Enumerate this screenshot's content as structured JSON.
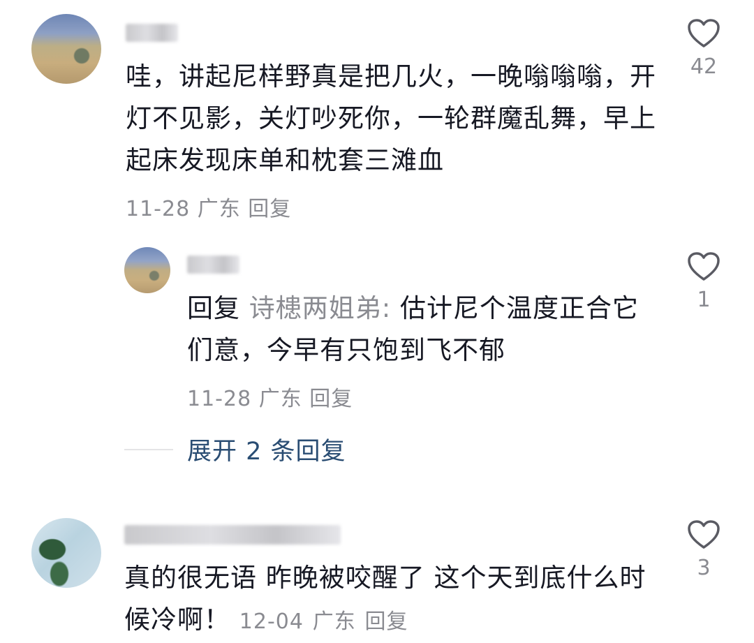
{
  "comments": [
    {
      "text": "哇，讲起尼样野真是把几火，一晚嗡嗡嗡，开灯不见影，关灯吵死你，一轮群魔乱舞，早上起床发现床单和枕套三滩血",
      "date": "11-28",
      "location": "广东",
      "reply_label": "回复",
      "likes": "42"
    },
    {
      "reply_prefix": "回复",
      "reply_to": "诗槵两姐弟:",
      "text": "估计尼个温度正合它们意，今早有只饱到飞不郁",
      "date": "11-28",
      "location": "广东",
      "reply_label": "回复",
      "likes": "1"
    },
    {
      "text": "真的很无语 昨晚被咬醒了 这个天到底什么时候冷啊！",
      "date": "12-04",
      "location": "广东",
      "reply_label": "回复",
      "likes": "3"
    }
  ],
  "expand_replies": "展开 2 条回复",
  "colors": {
    "text": "#161823",
    "meta": "#8a8b91",
    "link": "#2a4d73"
  },
  "icons": {
    "like": "heart-outline-icon"
  }
}
